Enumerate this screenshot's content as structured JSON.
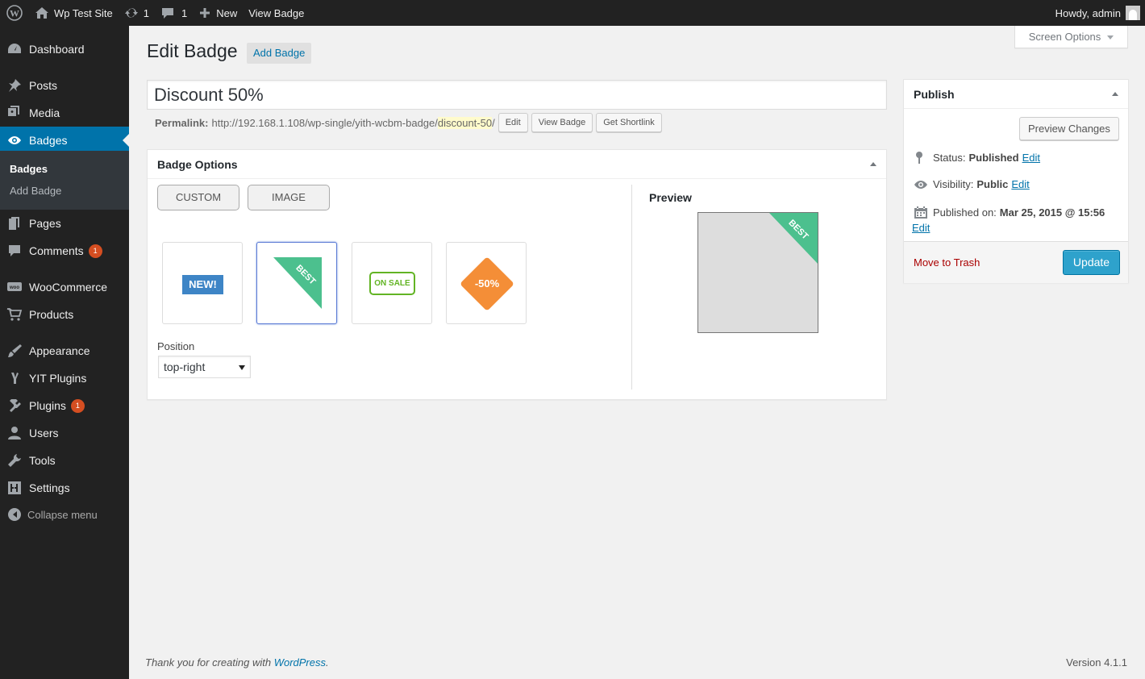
{
  "adminbar": {
    "site_name": "Wp Test Site",
    "updates_count": "1",
    "comments_count": "1",
    "new_label": "New",
    "view_label": "View Badge",
    "howdy": "Howdy, admin"
  },
  "sidebar": {
    "items": [
      {
        "label": "Dashboard",
        "icon": "dashboard-icon"
      },
      {
        "label": "Posts",
        "icon": "pushpin-icon"
      },
      {
        "label": "Media",
        "icon": "media-icon"
      },
      {
        "label": "Badges",
        "icon": "eye-icon"
      },
      {
        "label": "Pages",
        "icon": "pages-icon"
      },
      {
        "label": "Comments",
        "icon": "comment-icon",
        "badge": "1"
      },
      {
        "label": "WooCommerce",
        "icon": "woocommerce-icon"
      },
      {
        "label": "Products",
        "icon": "cart-icon"
      },
      {
        "label": "Appearance",
        "icon": "brush-icon"
      },
      {
        "label": "YIT Plugins",
        "icon": "yit-icon"
      },
      {
        "label": "Plugins",
        "icon": "plugin-icon",
        "badge": "1"
      },
      {
        "label": "Users",
        "icon": "user-icon"
      },
      {
        "label": "Tools",
        "icon": "wrench-icon"
      },
      {
        "label": "Settings",
        "icon": "settings-icon"
      }
    ],
    "submenu": [
      "Badges",
      "Add Badge"
    ],
    "collapse": "Collapse menu"
  },
  "screen_options": "Screen Options",
  "header": {
    "title": "Edit Badge",
    "add_new": "Add Badge"
  },
  "post": {
    "title": "Discount 50%",
    "permalink_label": "Permalink:",
    "permalink_base": "http://192.168.1.108/wp-single/yith-wcbm-badge/",
    "permalink_slug": "discount-50",
    "permalink_end": "/",
    "btn_edit": "Edit",
    "btn_view": "View Badge",
    "btn_shortlink": "Get Shortlink"
  },
  "badge_options": {
    "title": "Badge Options",
    "tabs": [
      "CUSTOM",
      "IMAGE"
    ],
    "badges": [
      {
        "text": "NEW!",
        "color": "#3e85c6"
      },
      {
        "text": "BEST",
        "color": "#4cc08e"
      },
      {
        "text": "ON SALE",
        "color": "#62b424"
      },
      {
        "text": "-50%",
        "color": "#f48e37"
      }
    ],
    "selected_badge": "BEST",
    "preview_label": "Preview",
    "preview_badge": "BEST",
    "position_label": "Position",
    "position_value": "top-right"
  },
  "publish": {
    "title": "Publish",
    "preview_changes": "Preview Changes",
    "status_label": "Status:",
    "status_value": "Published",
    "visibility_label": "Visibility:",
    "visibility_value": "Public",
    "published_label": "Published on:",
    "published_value": "Mar 25, 2015 @ 15:56",
    "edit": "Edit",
    "trash": "Move to Trash",
    "update": "Update"
  },
  "footer": {
    "thanks": "Thank you for creating with ",
    "wordpress": "WordPress",
    "period": ".",
    "version": "Version 4.1.1"
  },
  "colors": {
    "accent": "#0073aa",
    "update_button": "#2ea2cc",
    "admin_bg": "#222222"
  }
}
